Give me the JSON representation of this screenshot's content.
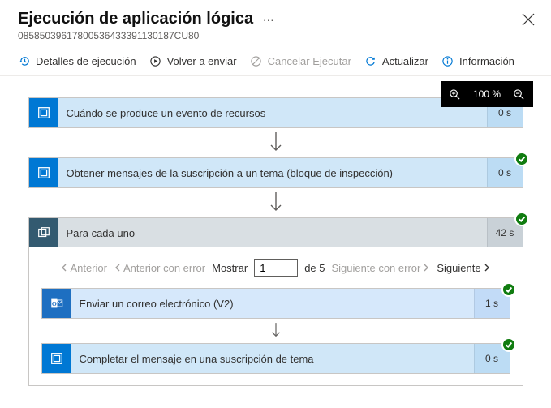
{
  "header": {
    "title": "Ejecución de aplicación lógica",
    "run_id": "08585039617800536433391130187CU80"
  },
  "toolbar": {
    "details": "Detalles de ejecución",
    "resend": "Volver a enviar",
    "cancel": "Cancelar Ejecutar",
    "refresh": "Actualizar",
    "info": "Información"
  },
  "zoom": {
    "level": "100 %"
  },
  "steps": {
    "trigger": {
      "title": "Cuándo se produce un evento de recursos",
      "time": "0 s"
    },
    "getmsgs": {
      "title": "Obtener mensajes de la suscripción a un tema (bloque de inspección)",
      "time": "0 s"
    },
    "foreach": {
      "title": "Para cada uno",
      "time": "42 s",
      "pager": {
        "prev": "Anterior",
        "prev_err": "Anterior con error",
        "show": "Mostrar",
        "value": "1",
        "of": "de 5",
        "next_err": "Siguiente con error",
        "next": "Siguiente"
      },
      "sendmail": {
        "title": "Enviar un correo electrónico (V2)",
        "time": "1 s"
      },
      "complete": {
        "title": "Completar el mensaje en una suscripción de tema",
        "time": "0 s"
      }
    }
  }
}
